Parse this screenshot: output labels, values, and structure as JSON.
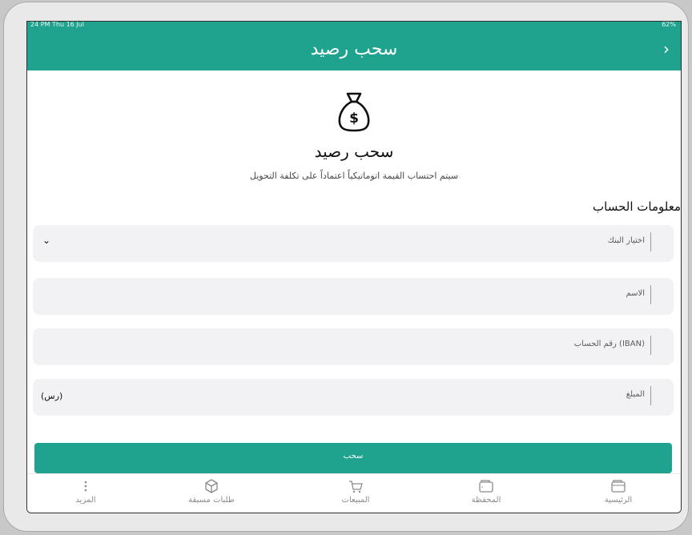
{
  "status_bar": {
    "time": "24 PM  Thu 16 Jul",
    "battery": "62%"
  },
  "app_bar": {
    "title": "سحب رصيد",
    "back_icon": "chevron-right-icon"
  },
  "hero": {
    "icon": "money-bag-icon",
    "title": "سحب رصيد",
    "subtitle": "سيتم احتساب القيمة اتوماتيكياً اعتماداً على تكلفة التحويل"
  },
  "account_section": {
    "title": "معلومات الحساب"
  },
  "form": {
    "bank": {
      "label": "اختيار البنك"
    },
    "name": {
      "label": "الاسم"
    },
    "iban": {
      "label": "رقم الحساب (IBAN)"
    },
    "amount": {
      "label": "المبلغ",
      "unit": "(رس)"
    },
    "submit_label": "سحب"
  },
  "tabbar": {
    "items": [
      {
        "label": "المزيد",
        "icon": "more-vertical-icon"
      },
      {
        "label": "طلبات مسبقة",
        "icon": "box-icon"
      },
      {
        "label": "المبيعات",
        "icon": "basket-icon"
      },
      {
        "label": "المحفظة",
        "icon": "wallet-icon"
      },
      {
        "label": "الرئيسية",
        "icon": "home-wallet-icon"
      }
    ]
  },
  "colors": {
    "primary": "#1fa38f",
    "field_bg": "#f2f2f4"
  }
}
